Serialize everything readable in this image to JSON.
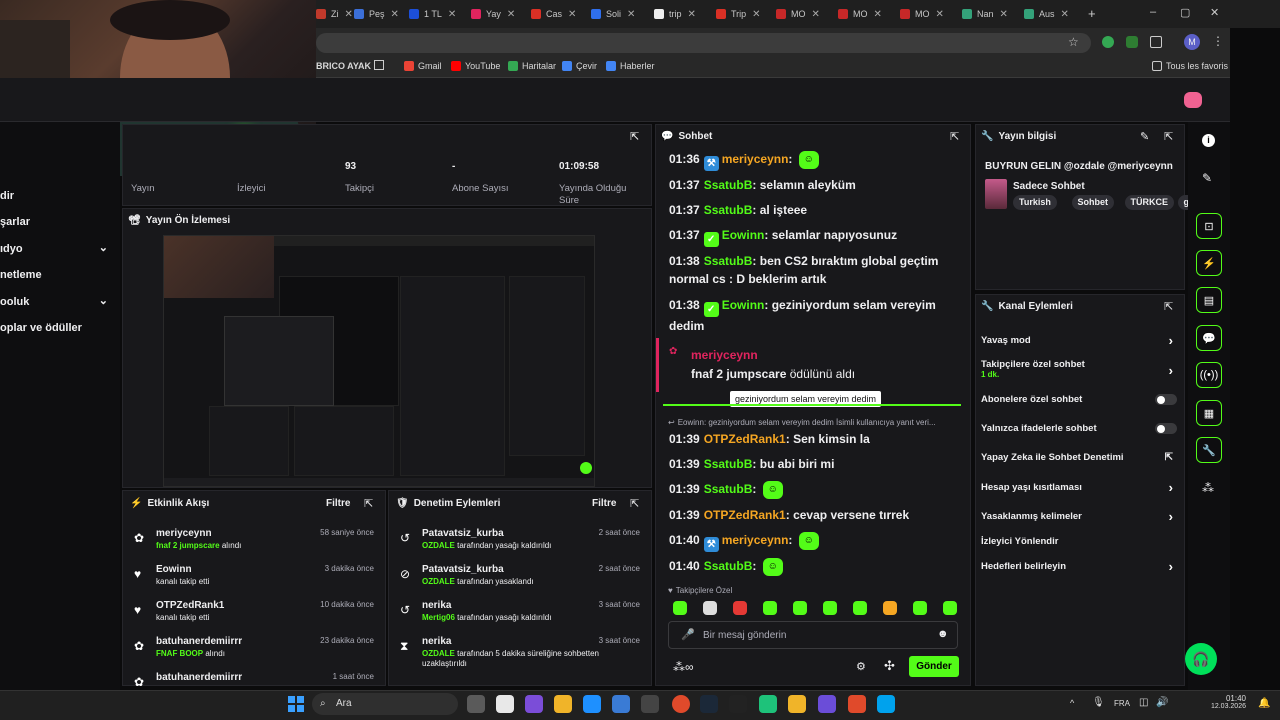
{
  "browser": {
    "tabs": [
      {
        "label": "Zi",
        "color": "#c0392b"
      },
      {
        "label": "Peş",
        "color": "#3b6fd8"
      },
      {
        "label": "1 TL",
        "color": "#1c4fd8"
      },
      {
        "label": "Yay",
        "color": "#e0245e"
      },
      {
        "label": "Cas",
        "color": "#d93025"
      },
      {
        "label": "Soli",
        "color": "#2f6fed"
      },
      {
        "label": "trip",
        "color": "#eeeeee"
      },
      {
        "label": "Trip",
        "color": "#d93025"
      },
      {
        "label": "MO",
        "color": "#c62828"
      },
      {
        "label": "MO",
        "color": "#c62828"
      },
      {
        "label": "MO",
        "color": "#c62828"
      },
      {
        "label": "Nan",
        "color": "#34a27a"
      },
      {
        "label": "Aus",
        "color": "#34a27a"
      }
    ],
    "new_tab": "+",
    "window_controls": [
      "–",
      "▢",
      "✕"
    ],
    "bookmarks": [
      {
        "label": "BRICO AYAK",
        "color": "#282828"
      },
      {
        "label": "Gmail",
        "color": "#ea4335"
      },
      {
        "label": "YouTube",
        "color": "#ff0000"
      },
      {
        "label": "Haritalar",
        "color": "#34a853"
      },
      {
        "label": "Çevir",
        "color": "#4285f4"
      },
      {
        "label": "Haberler",
        "color": "#4285f4"
      }
    ],
    "all_bookmarks": "Tous les favoris",
    "profile_initial": "M"
  },
  "left_menu": [
    "dir",
    "şarlar",
    "ıdyo",
    "netleme",
    "ooluk",
    "oplar ve ödüller"
  ],
  "stats": [
    {
      "value": "",
      "label": "Yayın"
    },
    {
      "value": "",
      "label": "İzleyici"
    },
    {
      "value": "93",
      "label": "Takipçi"
    },
    {
      "value": "-",
      "label": "Abone Sayısı"
    },
    {
      "value": "01:09:58",
      "label": "Yayında Olduğu Süre"
    }
  ],
  "preview": {
    "title": "Yayın Ön İzlemesi"
  },
  "activity": {
    "title": "Etkinlik Akışı",
    "filter": "Filtre",
    "items": [
      {
        "icon": "gift-icon",
        "name": "meriyceynn",
        "sub_hl": "fnaf 2 jumpscare",
        "sub": "alındı",
        "time": "58 saniye önce"
      },
      {
        "icon": "heart-icon",
        "name": "Eowinn",
        "sub_hl": "",
        "sub": "kanalı takip etti",
        "time": "3 dakika önce"
      },
      {
        "icon": "heart-icon",
        "name": "OTPZedRank1",
        "sub_hl": "",
        "sub": "kanalı takip etti",
        "time": "10 dakika önce"
      },
      {
        "icon": "gift-icon",
        "name": "batuhanerdemiirrr",
        "sub_hl": "FNAF BOOP",
        "sub": "alındı",
        "time": "23 dakika önce"
      },
      {
        "icon": "gift-icon",
        "name": "batuhanerdemiirrr",
        "sub_hl": "",
        "sub": "",
        "time": "1 saat önce"
      }
    ]
  },
  "moderation": {
    "title": "Denetim Eylemleri",
    "filter": "Filtre",
    "items": [
      {
        "icon": "undo-icon",
        "name": "Patavatsiz_kurba",
        "sub_hl": "OZDALE",
        "sub": "tarafından yasağı kaldırıldı",
        "time": "2 saat önce"
      },
      {
        "icon": "ban-icon",
        "name": "Patavatsiz_kurba",
        "sub_hl": "OZDALE",
        "sub": "tarafından yasaklandı",
        "time": "2 saat önce"
      },
      {
        "icon": "undo-icon",
        "name": "nerika",
        "sub_hl": "Mertig06",
        "sub": "tarafından yasağı kaldırıldı",
        "time": "3 saat önce"
      },
      {
        "icon": "hourglass-icon",
        "name": "nerika",
        "sub_hl": "OZDALE",
        "sub": "tarafından 5 dakika süreliğine sohbetten uzaklaştırıldı",
        "time": "3 saat önce"
      }
    ]
  },
  "chat": {
    "title": "Sohbet",
    "messages": [
      {
        "time": "01:36",
        "user": "meriyceynn",
        "color": "#f5a623",
        "text": "",
        "badge": "hammer",
        "emote": true
      },
      {
        "time": "01:37",
        "user": "SsatubB",
        "color": "#53fc18",
        "text": "selamın aleyküm",
        "badge": "",
        "emote": false
      },
      {
        "time": "01:37",
        "user": "SsatubB",
        "color": "#53fc18",
        "text": "al işteee",
        "badge": "",
        "emote": false
      },
      {
        "time": "01:37",
        "user": "Eowinn",
        "color": "#53fc18",
        "text": "selamlar napıyosunuz",
        "badge": "check",
        "emote": false
      },
      {
        "time": "01:38",
        "user": "SsatubB",
        "color": "#53fc18",
        "text": "ben CS2 bıraktım global geçtim normal cs : D beklerim artık",
        "badge": "",
        "emote": false
      },
      {
        "time": "01:38",
        "user": "Eowinn",
        "color": "#53fc18",
        "text": "geziniyordum selam vereyim dedim",
        "badge": "check",
        "emote": false
      }
    ],
    "reward": {
      "user": "meriyceynn",
      "item": "fnaf 2 jumpscare",
      "suffix": "ödülünü aldı"
    },
    "tooltip": "geziniyordum selam vereyim dedim",
    "reply_line": "Eowinn: geziniyordum selam vereyim dedim İsimli kullanıcıya yanıt veri...",
    "messages2": [
      {
        "time": "01:39",
        "user": "OTPZedRank1",
        "color": "#f5a623",
        "text": "Sen kimsin la",
        "badge": "",
        "emote": false
      },
      {
        "time": "01:39",
        "user": "SsatubB",
        "color": "#53fc18",
        "text": "bu abi biri mi",
        "badge": "",
        "emote": false
      },
      {
        "time": "01:39",
        "user": "SsatubB",
        "color": "#53fc18",
        "text": "",
        "badge": "",
        "emote": true
      },
      {
        "time": "01:39",
        "user": "OTPZedRank1",
        "color": "#f5a623",
        "text": "cevap versene tırrek",
        "badge": "",
        "emote": false
      },
      {
        "time": "01:40",
        "user": "meriyceynn",
        "color": "#f5a623",
        "text": "",
        "badge": "hammer",
        "emote": true
      },
      {
        "time": "01:40",
        "user": "SsatubB",
        "color": "#53fc18",
        "text": "",
        "badge": "",
        "emote": true
      }
    ],
    "followers_only": "Takipçilere Özel",
    "input_placeholder": "Bir mesaj gönderin",
    "send": "Gönder"
  },
  "stream_info": {
    "title": "Yayın bilgisi",
    "stream_title": "BUYRUN GELIN @ozdale @meriyceynn",
    "category": "Sadece Sohbet",
    "tags": [
      "Turkish",
      "Sohbet",
      "TÜRKCE",
      "g"
    ]
  },
  "channel_actions": {
    "title": "Kanal Eylemleri",
    "items": [
      {
        "label": "Yavaş mod",
        "sub": "",
        "control": "chevron"
      },
      {
        "label": "Takipçilere özel sohbet",
        "sub": "1 dk.",
        "control": "chevron"
      },
      {
        "label": "Abonelere özel sohbet",
        "sub": "",
        "control": "toggle"
      },
      {
        "label": "Yalnızca ifadelerle sohbet",
        "sub": "",
        "control": "toggle"
      },
      {
        "label": "Yapay Zeka ile Sohbet Denetimi",
        "sub": "",
        "control": "external"
      },
      {
        "label": "Hesap yaşı kısıtlaması",
        "sub": "",
        "control": "chevron"
      },
      {
        "label": "Yasaklanmış kelimeler",
        "sub": "",
        "control": "chevron"
      },
      {
        "label": "İzleyici Yönlendir",
        "sub": "",
        "control": "none"
      },
      {
        "label": "Hedefleri belirleyin",
        "sub": "",
        "control": "chevron"
      }
    ]
  },
  "taskbar": {
    "search": "Ara",
    "lang": "FRA",
    "time": "01:40",
    "date": "12.03.2026"
  }
}
